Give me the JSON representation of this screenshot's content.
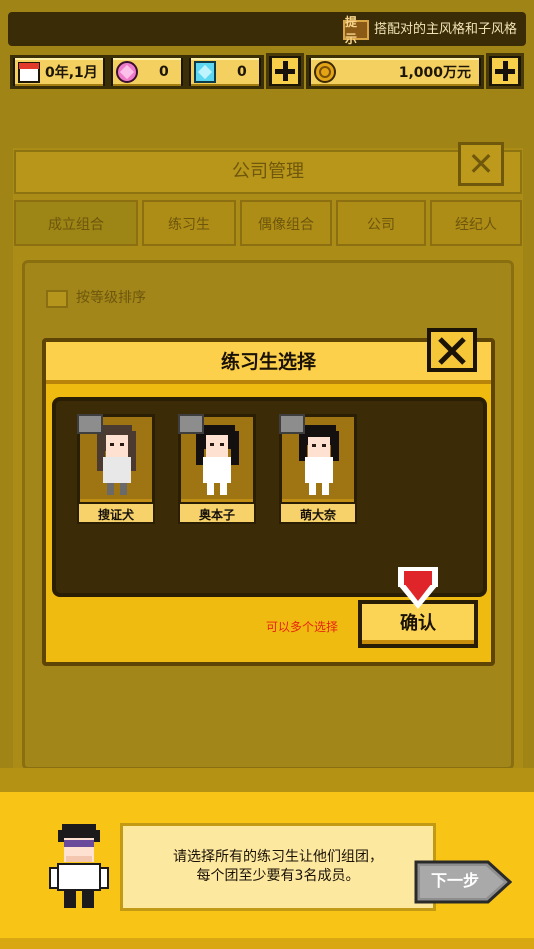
{
  "hint": {
    "icon_label": "提示",
    "text": "搭配对的主风格和子风格"
  },
  "resources": {
    "date": "0年,1月",
    "pink_gems": "0",
    "blue_gems": "0",
    "money": "1,000万元"
  },
  "background": {
    "title": "公司管理",
    "tabs": [
      "成立组合",
      "练习生",
      "偶像组合",
      "公司",
      "经纪人"
    ],
    "checkbox_label": "按等级排序"
  },
  "dialog": {
    "title": "练习生选择",
    "trainees": [
      {
        "name": "搜证犬"
      },
      {
        "name": "奥本子"
      },
      {
        "name": "萌大奈"
      }
    ],
    "note": "可以多个选择",
    "confirm_label": "确认"
  },
  "tutorial": {
    "line1": "请选择所有的练习生让他们组团，",
    "line2": "每个团至少要有3名成员。",
    "next_label": "下一步"
  },
  "colors": {
    "accent": "#f8c416",
    "dialog_bg": "#f0bb11",
    "note_red": "#e7250f"
  }
}
